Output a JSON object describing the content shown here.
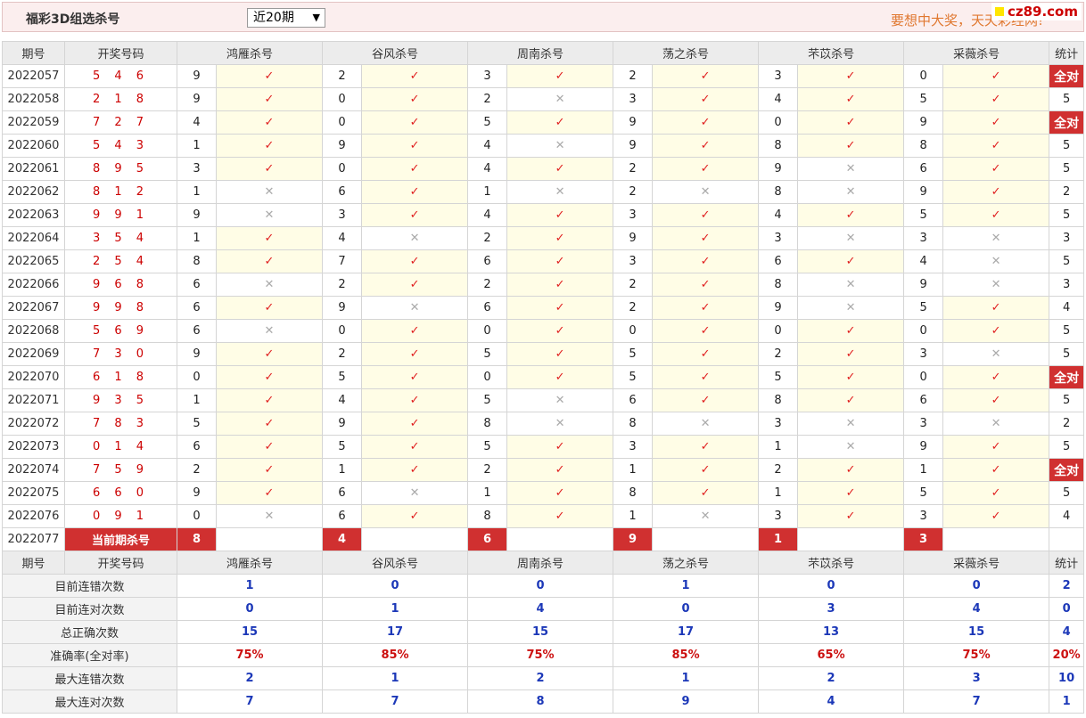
{
  "header": {
    "title": "福彩3D组选杀号",
    "period_select": "近20期",
    "slogan": "要想中大奖，天天彩经网!",
    "logo": "cz89.com"
  },
  "columns": [
    "期号",
    "开奖号码",
    "鸿雁杀号",
    "谷风杀号",
    "周南杀号",
    "荡之杀号",
    "芣苡杀号",
    "采薇杀号",
    "统计"
  ],
  "rows": [
    {
      "issue": "2022057",
      "draw": "546",
      "kills": [
        9,
        2,
        3,
        2,
        3,
        0
      ],
      "hits": [
        1,
        1,
        1,
        1,
        1,
        1
      ],
      "count": "全对"
    },
    {
      "issue": "2022058",
      "draw": "218",
      "kills": [
        9,
        0,
        2,
        3,
        4,
        5
      ],
      "hits": [
        1,
        1,
        0,
        1,
        1,
        1
      ],
      "count": "5"
    },
    {
      "issue": "2022059",
      "draw": "727",
      "kills": [
        4,
        0,
        5,
        9,
        0,
        9
      ],
      "hits": [
        1,
        1,
        1,
        1,
        1,
        1
      ],
      "count": "全对"
    },
    {
      "issue": "2022060",
      "draw": "543",
      "kills": [
        1,
        9,
        4,
        9,
        8,
        8
      ],
      "hits": [
        1,
        1,
        0,
        1,
        1,
        1
      ],
      "count": "5"
    },
    {
      "issue": "2022061",
      "draw": "895",
      "kills": [
        3,
        0,
        4,
        2,
        9,
        6
      ],
      "hits": [
        1,
        1,
        1,
        1,
        0,
        1
      ],
      "count": "5"
    },
    {
      "issue": "2022062",
      "draw": "812",
      "kills": [
        1,
        6,
        1,
        2,
        8,
        9
      ],
      "hits": [
        0,
        1,
        0,
        0,
        0,
        1
      ],
      "count": "2"
    },
    {
      "issue": "2022063",
      "draw": "991",
      "kills": [
        9,
        3,
        4,
        3,
        4,
        5
      ],
      "hits": [
        0,
        1,
        1,
        1,
        1,
        1
      ],
      "count": "5"
    },
    {
      "issue": "2022064",
      "draw": "354",
      "kills": [
        1,
        4,
        2,
        9,
        3,
        3
      ],
      "hits": [
        1,
        0,
        1,
        1,
        0,
        0
      ],
      "count": "3"
    },
    {
      "issue": "2022065",
      "draw": "254",
      "kills": [
        8,
        7,
        6,
        3,
        6,
        4
      ],
      "hits": [
        1,
        1,
        1,
        1,
        1,
        0
      ],
      "count": "5"
    },
    {
      "issue": "2022066",
      "draw": "968",
      "kills": [
        6,
        2,
        2,
        2,
        8,
        9
      ],
      "hits": [
        0,
        1,
        1,
        1,
        0,
        0
      ],
      "count": "3"
    },
    {
      "issue": "2022067",
      "draw": "998",
      "kills": [
        6,
        9,
        6,
        2,
        9,
        5
      ],
      "hits": [
        1,
        0,
        1,
        1,
        0,
        1
      ],
      "count": "4"
    },
    {
      "issue": "2022068",
      "draw": "569",
      "kills": [
        6,
        0,
        0,
        0,
        0,
        0
      ],
      "hits": [
        0,
        1,
        1,
        1,
        1,
        1
      ],
      "count": "5"
    },
    {
      "issue": "2022069",
      "draw": "730",
      "kills": [
        9,
        2,
        5,
        5,
        2,
        3
      ],
      "hits": [
        1,
        1,
        1,
        1,
        1,
        0
      ],
      "count": "5"
    },
    {
      "issue": "2022070",
      "draw": "618",
      "kills": [
        0,
        5,
        0,
        5,
        5,
        0
      ],
      "hits": [
        1,
        1,
        1,
        1,
        1,
        1
      ],
      "count": "全对"
    },
    {
      "issue": "2022071",
      "draw": "935",
      "kills": [
        1,
        4,
        5,
        6,
        8,
        6
      ],
      "hits": [
        1,
        1,
        0,
        1,
        1,
        1
      ],
      "count": "5"
    },
    {
      "issue": "2022072",
      "draw": "783",
      "kills": [
        5,
        9,
        8,
        8,
        3,
        3
      ],
      "hits": [
        1,
        1,
        0,
        0,
        0,
        0
      ],
      "count": "2"
    },
    {
      "issue": "2022073",
      "draw": "014",
      "kills": [
        6,
        5,
        5,
        3,
        1,
        9
      ],
      "hits": [
        1,
        1,
        1,
        1,
        0,
        1
      ],
      "count": "5"
    },
    {
      "issue": "2022074",
      "draw": "759",
      "kills": [
        2,
        1,
        2,
        1,
        2,
        1
      ],
      "hits": [
        1,
        1,
        1,
        1,
        1,
        1
      ],
      "count": "全对"
    },
    {
      "issue": "2022075",
      "draw": "660",
      "kills": [
        9,
        6,
        1,
        8,
        1,
        5
      ],
      "hits": [
        1,
        0,
        1,
        1,
        1,
        1
      ],
      "count": "5"
    },
    {
      "issue": "2022076",
      "draw": "091",
      "kills": [
        0,
        6,
        8,
        1,
        3,
        3
      ],
      "hits": [
        0,
        1,
        1,
        0,
        1,
        1
      ],
      "count": "4"
    }
  ],
  "current": {
    "issue": "2022077",
    "label": "当前期杀号",
    "kills": [
      "8",
      "4",
      "6",
      "9",
      "1",
      "3"
    ]
  },
  "stats": [
    {
      "label": "目前连错次数",
      "values": [
        "1",
        "0",
        "0",
        "1",
        "0",
        "0"
      ],
      "total": "2"
    },
    {
      "label": "目前连对次数",
      "values": [
        "0",
        "1",
        "4",
        "0",
        "3",
        "4"
      ],
      "total": "0"
    },
    {
      "label": "总正确次数",
      "values": [
        "15",
        "17",
        "15",
        "17",
        "13",
        "15"
      ],
      "total": "4"
    },
    {
      "label": "准确率(全对率)",
      "values": [
        "75%",
        "85%",
        "75%",
        "85%",
        "65%",
        "75%"
      ],
      "total": "20%",
      "rate": true
    },
    {
      "label": "最大连错次数",
      "values": [
        "2",
        "1",
        "2",
        "1",
        "2",
        "3"
      ],
      "total": "10"
    },
    {
      "label": "最大连对次数",
      "values": [
        "7",
        "7",
        "8",
        "9",
        "4",
        "7"
      ],
      "total": "1"
    }
  ],
  "marks": {
    "hit": "✓",
    "miss": "✕"
  },
  "colors": {
    "accent_red": "#d03030",
    "hit_bg": "#fffde6",
    "stat_blue": "#1c38b8",
    "header_bg": "#ececec"
  }
}
